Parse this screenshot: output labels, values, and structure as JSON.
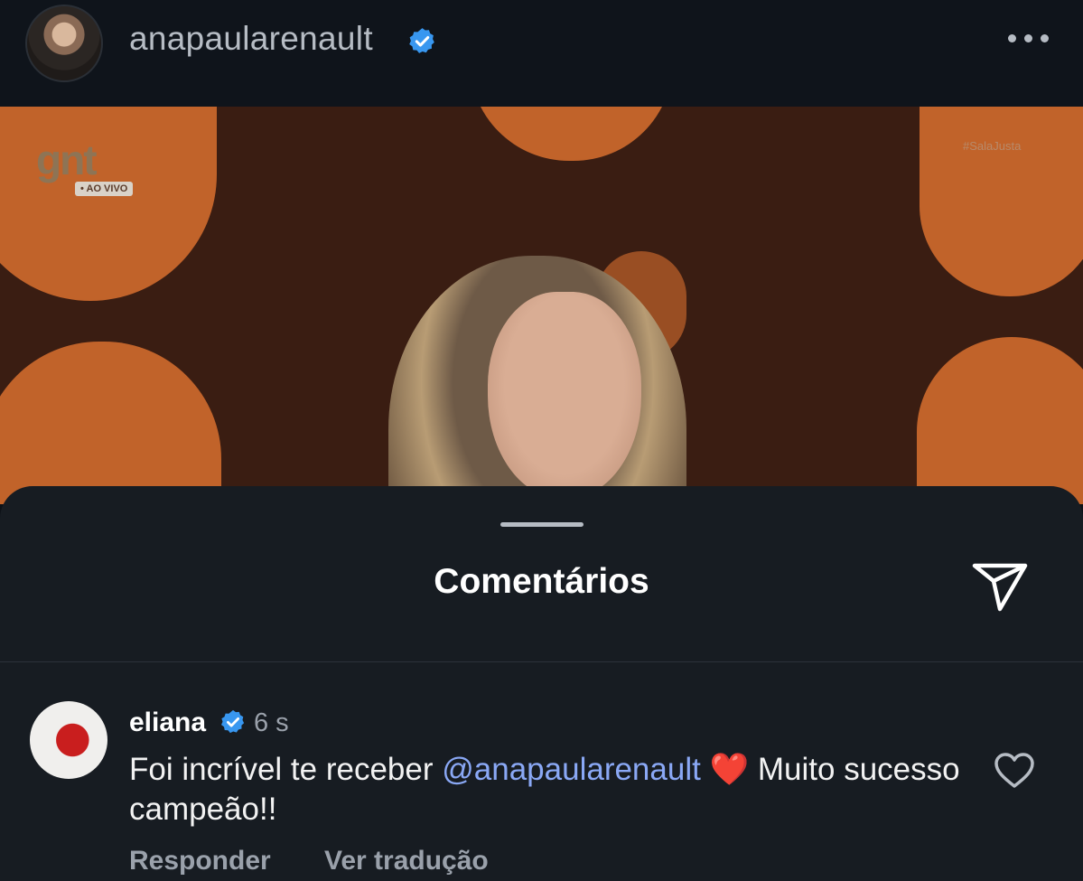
{
  "header": {
    "username": "anapaularenault",
    "verified": true,
    "more_icon": "more-horizontal-icon"
  },
  "video": {
    "channel_logo": "gnt",
    "live_label": "• AO VIVO",
    "hashtag": "#SalaJusta"
  },
  "comments_sheet": {
    "title": "Comentários",
    "share_icon": "send-icon",
    "comments": [
      {
        "username": "eliana",
        "verified": true,
        "time": "6 s",
        "text_before": "Foi incrível te receber ",
        "mention": "@anapaularenault",
        "emoji": "❤️",
        "text_after": " Muito sucesso campeão!!",
        "reply_label": "Responder",
        "translate_label": "Ver tradução",
        "like_icon": "heart-outline-icon"
      }
    ]
  },
  "colors": {
    "background": "#0f141b",
    "sheet": "#171c22",
    "mention": "#8aa8f5",
    "verified": "#3897f0",
    "video_orange": "#d9702f"
  }
}
